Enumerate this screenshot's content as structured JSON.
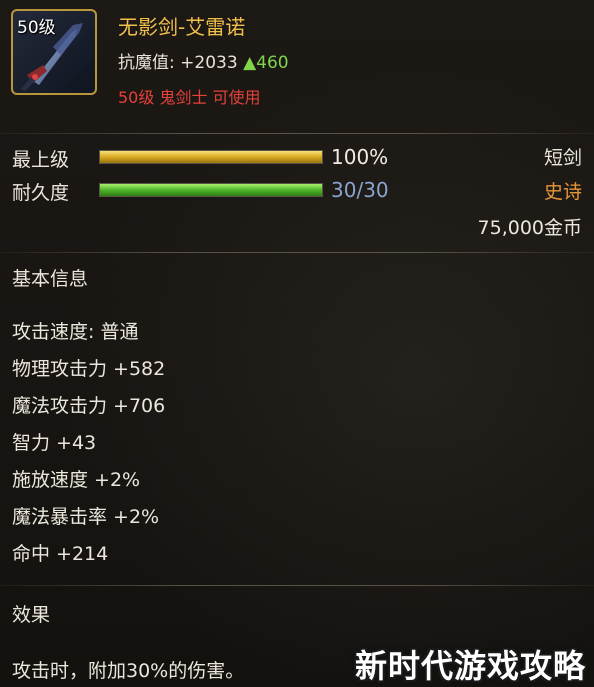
{
  "item": {
    "level_tag": "50级",
    "name": "无影剑-艾雷诺",
    "resist_label": "抗魔值:",
    "resist_value": "+2033",
    "resist_delta": "▲460",
    "requirement": "50级 鬼剑士 可使用"
  },
  "bars": {
    "upgrade": {
      "label": "最上级",
      "value_text": "100%",
      "fill_fraction": 1.0
    },
    "durability": {
      "label": "耐久度",
      "value_text": "30/30",
      "fill_fraction": 1.0
    }
  },
  "right_info": {
    "type": "短剑",
    "rarity": "史诗",
    "price": "75,000金币"
  },
  "basic_info": {
    "title": "基本信息",
    "stats": [
      "攻击速度: 普通",
      "物理攻击力 +582",
      "魔法攻击力 +706",
      "智力 +43",
      "施放速度 +2%",
      "魔法暴击率 +2%",
      "命中 +214"
    ]
  },
  "effect": {
    "title": "效果",
    "text": "攻击时，附加30%的伤害。"
  },
  "watermark": "新时代游戏攻略",
  "colors": {
    "name_gold": "#f2c04a",
    "requirement_red": "#e6403a",
    "delta_green": "#7fd64a",
    "rarity_orange": "#e8963a",
    "durability_blue": "#8aa3cf"
  }
}
